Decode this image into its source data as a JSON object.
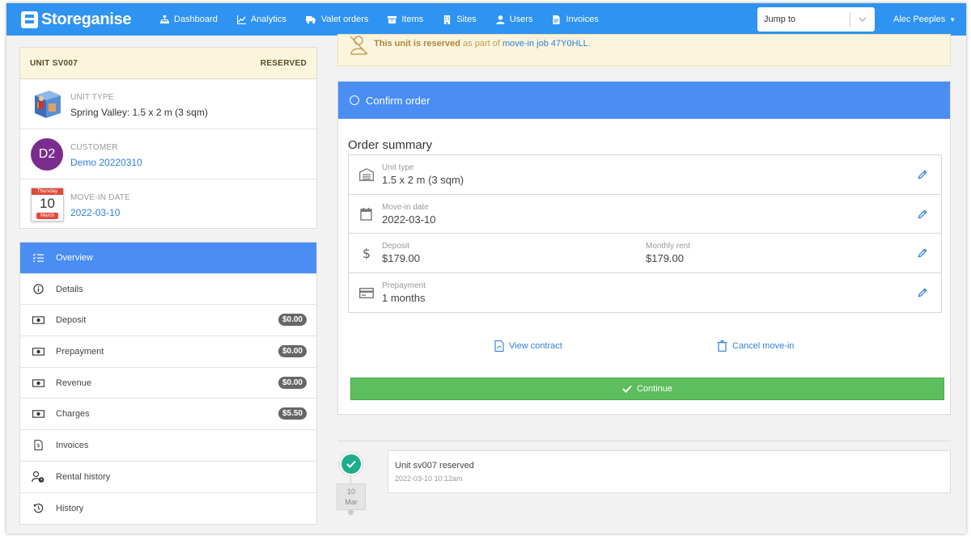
{
  "nav": {
    "brand": "Storeganise",
    "items": [
      {
        "label": "Dashboard",
        "icon": "sitemap-icon"
      },
      {
        "label": "Analytics",
        "icon": "chart-line-icon"
      },
      {
        "label": "Valet orders",
        "icon": "truck-icon"
      },
      {
        "label": "Items",
        "icon": "archive-icon"
      },
      {
        "label": "Sites",
        "icon": "building-icon"
      },
      {
        "label": "Users",
        "icon": "user-icon"
      },
      {
        "label": "Invoices",
        "icon": "file-invoice-icon"
      }
    ],
    "jump_placeholder": "Jump to",
    "user_name": "Alec Peeples"
  },
  "unit": {
    "code": "UNIT SV007",
    "status": "RESERVED",
    "unit_type_label": "UNIT TYPE",
    "unit_type_value": "Spring Valley: 1.5 x 2 m (3 sqm)",
    "customer_label": "CUSTOMER",
    "customer_initials": "D2",
    "customer_name": "Demo 20220310",
    "movein_label": "MOVE-IN DATE",
    "movein_value": "2022-03-10",
    "calendar": {
      "weekday": "Thursday",
      "day": "10",
      "month": "March"
    }
  },
  "menu": [
    {
      "label": "Overview",
      "icon": "tasks-icon",
      "active": true,
      "badge": null
    },
    {
      "label": "Details",
      "icon": "info-circle-icon",
      "active": false,
      "badge": null
    },
    {
      "label": "Deposit",
      "icon": "money-bill-icon",
      "active": false,
      "badge": "$0.00"
    },
    {
      "label": "Prepayment",
      "icon": "money-bill-icon",
      "active": false,
      "badge": "$0.00"
    },
    {
      "label": "Revenue",
      "icon": "money-bill-icon",
      "active": false,
      "badge": "$0.00"
    },
    {
      "label": "Charges",
      "icon": "money-bill-icon",
      "active": false,
      "badge": "$5.50"
    },
    {
      "label": "Invoices",
      "icon": "invoice-icon",
      "active": false,
      "badge": null
    },
    {
      "label": "Rental history",
      "icon": "user-clock-icon",
      "active": false,
      "badge": null
    },
    {
      "label": "History",
      "icon": "history-icon",
      "active": false,
      "badge": null
    }
  ],
  "notice": {
    "bold": "This unit is reserved",
    "middle": " as part of ",
    "link": "move-in job 47Y0HLL",
    "end": "."
  },
  "order": {
    "confirm_label": "Confirm order",
    "summary_title": "Order summary",
    "rows": [
      {
        "label": "Unit type",
        "value": "1.5 x 2 m (3 sqm)",
        "icon": "warehouse-icon"
      },
      {
        "label": "Move-in date",
        "value": "2022-03-10",
        "icon": "calendar-icon"
      },
      {
        "label": "Deposit",
        "value": "$179.00",
        "label2": "Monthly rent",
        "value2": "$179.00",
        "icon": "dollar-icon"
      },
      {
        "label": "Prepayment",
        "value": "1 months",
        "icon": "credit-card-icon"
      }
    ],
    "view_contract": "View contract",
    "cancel_movein": "Cancel move-in",
    "continue_label": "Continue"
  },
  "timeline": {
    "date_day": "10",
    "date_month": "Mar",
    "event_title": "Unit sv007 reserved",
    "event_time": "2022-03-10 10:12am"
  },
  "colors": {
    "primary": "#2f93f1",
    "active": "#4a8ef3",
    "success": "#5cbe5c",
    "warning_bg": "#fbf5dd",
    "link": "#2f7fd8"
  }
}
